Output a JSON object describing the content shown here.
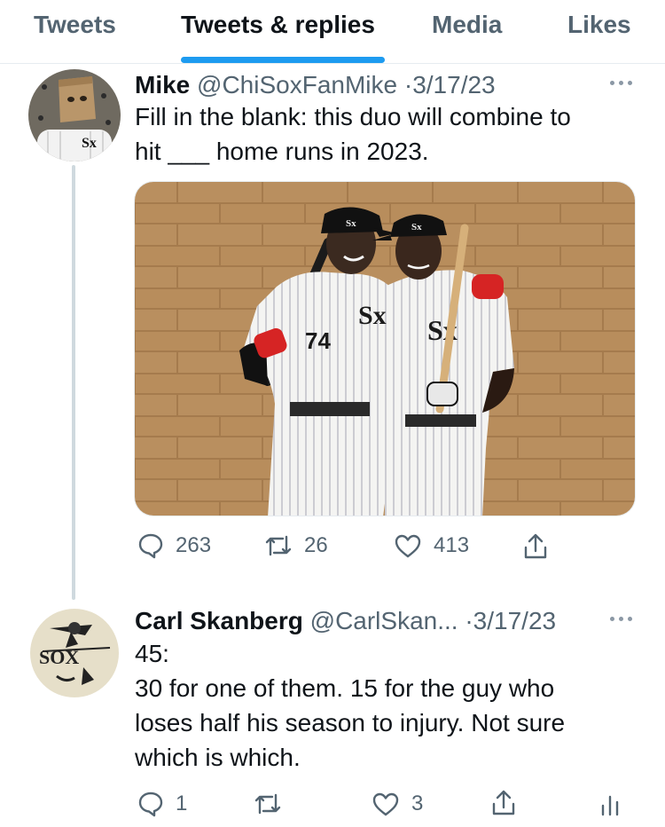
{
  "tabs": [
    {
      "label": "Tweets",
      "active": false
    },
    {
      "label": "Tweets & replies",
      "active": true
    },
    {
      "label": "Media",
      "active": false
    },
    {
      "label": "Likes",
      "active": false
    }
  ],
  "accent_color": "#1d9bf0",
  "tweets": [
    {
      "name": "Mike",
      "handle": "@ChiSoxFanMike",
      "separator": "·",
      "date": "3/17/23",
      "text_lines": [
        "Fill in the blank: this duo will combine to",
        "hit ___ home runs in 2023."
      ],
      "has_image": true,
      "image_icon": "two-players-photo",
      "jersey_number": "74",
      "actions": {
        "replies": "263",
        "retweets": "26",
        "likes": "413"
      }
    },
    {
      "name": "Carl Skanberg",
      "handle": "@CarlSkan...",
      "separator": "·",
      "date": "3/17/23",
      "text_lines": [
        "45:",
        "30 for one of them. 15 for the guy who",
        "loses half his season to injury. Not sure",
        "which is which."
      ],
      "has_image": false,
      "actions": {
        "replies": "1",
        "retweets": "",
        "likes": "3"
      }
    }
  ]
}
